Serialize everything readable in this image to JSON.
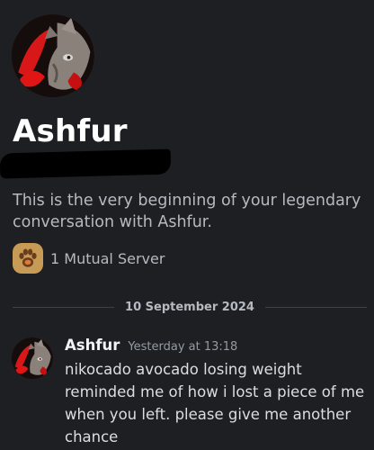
{
  "profile": {
    "username": "Ashfur",
    "intro": "This is the very beginning of your legendary conversation with Ashfur.",
    "mutual_servers": "1 Mutual Server"
  },
  "divider": {
    "date": "10 September 2024"
  },
  "message": {
    "author": "Ashfur",
    "timestamp": "Yesterday at 13:18",
    "text": "nikocado avocado losing weight reminded me of how i lost a piece of me when you left. please give me another chance"
  },
  "colors": {
    "background": "#1e1f22",
    "text_primary": "#f2f3f5",
    "text_muted": "#b5bac1",
    "avatar_accent": "#e01515"
  },
  "icons": {
    "server": "paw-print-icon"
  }
}
